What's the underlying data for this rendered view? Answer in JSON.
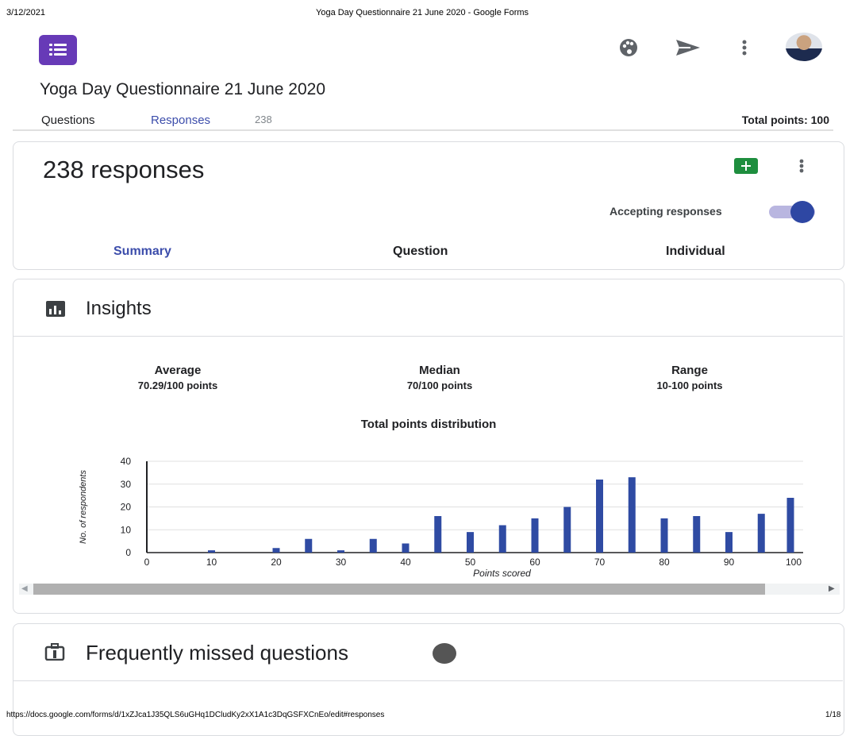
{
  "print": {
    "date": "3/12/2021",
    "doc_title": "Yoga Day Questionnaire 21 June 2020 - Google Forms",
    "url": "https://docs.google.com/forms/d/1xZJca1J35QLS6uGHq1DCludKy2xX1A1c3DqGSFXCnEo/edit#responses",
    "page": "1/18"
  },
  "header": {
    "icons": [
      "palette-icon",
      "send-icon",
      "more-vert-icon",
      "account-avatar"
    ]
  },
  "form": {
    "title": "Yoga Day Questionnaire 21 June 2020"
  },
  "nav": {
    "tabs": [
      {
        "label": "Questions",
        "active": false
      },
      {
        "label": "Responses",
        "active": true,
        "count": "238"
      }
    ],
    "total_points": "Total points: 100"
  },
  "responses_card": {
    "count_text": "238 responses",
    "accepting_label": "Accepting responses",
    "accepting_on": true,
    "tabs": [
      "Summary",
      "Question",
      "Individual"
    ],
    "active_tab": "Summary"
  },
  "insights": {
    "title": "Insights",
    "stats": [
      {
        "label": "Average",
        "value": "70.29/100 points"
      },
      {
        "label": "Median",
        "value": "70/100 points"
      },
      {
        "label": "Range",
        "value": "10-100 points"
      }
    ]
  },
  "chart_data": {
    "type": "bar",
    "title": "Total points distribution",
    "xlabel": "Points scored",
    "ylabel": "No. of respondents",
    "x": [
      10,
      20,
      25,
      30,
      35,
      40,
      45,
      50,
      55,
      60,
      65,
      70,
      75,
      80,
      85,
      90,
      95,
      100
    ],
    "values": [
      1,
      2,
      6,
      1,
      6,
      4,
      16,
      9,
      12,
      15,
      20,
      32,
      33,
      15,
      16,
      9,
      17,
      24
    ],
    "xlim": [
      0,
      100
    ],
    "ylim": [
      0,
      40
    ],
    "xticks": [
      0,
      10,
      20,
      30,
      40,
      50,
      60,
      70,
      80,
      90,
      100
    ],
    "yticks": [
      0,
      10,
      20,
      30,
      40
    ],
    "grid": true,
    "bar_color": "#2f4ba3"
  },
  "missed": {
    "title": "Frequently missed questions"
  },
  "colors": {
    "accent": "#3c4dab",
    "forms_purple": "#673ab7",
    "sheets_green": "#1e8e3e"
  }
}
